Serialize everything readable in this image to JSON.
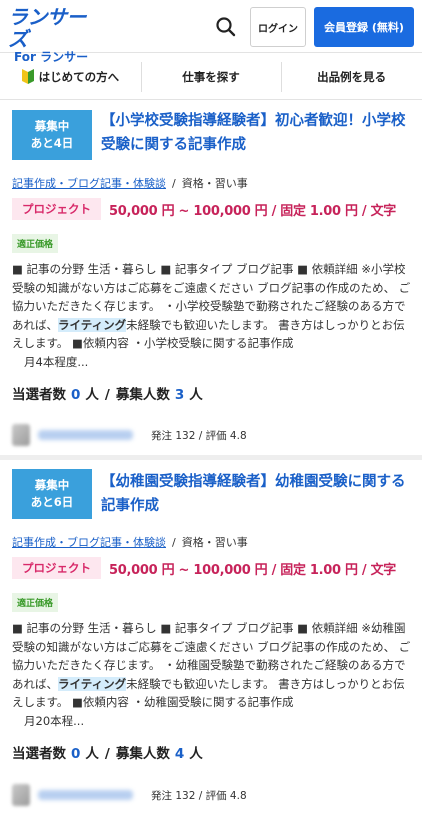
{
  "header": {
    "logo_main": "ランサーズ",
    "logo_for": "For",
    "logo_sub": "ランサー",
    "login_label": "ログイン",
    "register_label": "会員登録 (無料)"
  },
  "nav": {
    "items": [
      {
        "label": "はじめての方へ"
      },
      {
        "label": "仕事を探す"
      },
      {
        "label": "出品例を見る"
      }
    ]
  },
  "jobs": [
    {
      "status_line1": "募集中",
      "status_line2": "あと4日",
      "title": "【小学校受験指導経験者】初心者歓迎！小学校受験に関する記事作成",
      "category_link": "記事作成・ブログ記事・体験談",
      "category_sub": "資格・習い事",
      "type": "プロジェクト",
      "price": "50,000 円 ~ 100,000 円 / 固定 1.00 円 / 文字",
      "fair_badge": "適正価格",
      "desc_before": "■ 記事の分野 生活・暮らし ■ 記事タイプ ブログ記事 ■ 依頼詳細 ※小学校受験の知識がない方はご応募をご遠慮ください ブログ記事の作成のため、 ご協力いただきたく存じます。 ・小学校受験塾で勤務されたご経験のある方であれば、",
      "desc_highlight": "ライティング",
      "desc_after": "未経験でも歓迎いたします。 書き方はしっかりとお伝えします。 ■依頼内容 ・小学校受験に関する記事作成",
      "desc_tail": "月4本程度...",
      "winners_label": "当選者数",
      "winners_value": "0",
      "winners_unit": "人",
      "recruit_label": "募集人数",
      "recruit_value": "3",
      "recruit_unit": "人",
      "client_meta": "発注 132 / 評価 4.8"
    },
    {
      "status_line1": "募集中",
      "status_line2": "あと6日",
      "title": "【幼稚園受験指導経験者】幼稚園受験に関する記事作成",
      "category_link": "記事作成・ブログ記事・体験談",
      "category_sub": "資格・習い事",
      "type": "プロジェクト",
      "price": "50,000 円 ~ 100,000 円 / 固定 1.00 円 / 文字",
      "fair_badge": "適正価格",
      "desc_before": "■ 記事の分野 生活・暮らし ■ 記事タイプ ブログ記事 ■ 依頼詳細 ※幼稚園受験の知識がない方はご応募をご遠慮ください ブログ記事の作成のため、 ご協力いただきたく存じます。 ・幼稚園受験塾で勤務されたご経験のある方であれば、",
      "desc_highlight": "ライティング",
      "desc_after": "未経験でも歓迎いたします。 書き方はしっかりとお伝えします。 ■依頼内容 ・幼稚園受験に関する記事作成",
      "desc_tail": "月20本程...",
      "winners_label": "当選者数",
      "winners_value": "0",
      "winners_unit": "人",
      "recruit_label": "募集人数",
      "recruit_value": "4",
      "recruit_unit": "人",
      "client_meta": "発注 132 / 評価 4.8"
    }
  ],
  "colors": {
    "brand": "#1a5fc8",
    "register": "#1a6be0",
    "status_badge": "#3aa0dc",
    "price": "#c7235a",
    "fair": "#3a9a2a"
  }
}
